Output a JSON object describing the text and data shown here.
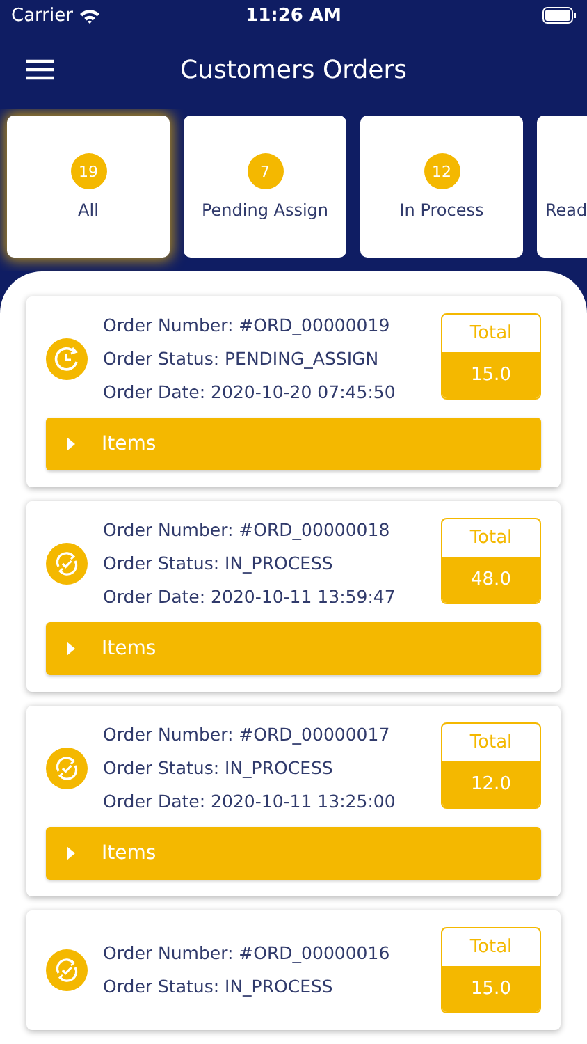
{
  "status_bar": {
    "carrier": "Carrier",
    "time": "11:26 AM"
  },
  "header": {
    "title": "Customers Orders"
  },
  "tabs": [
    {
      "count": "19",
      "label": "All",
      "selected": true
    },
    {
      "count": "7",
      "label": "Pending Assign",
      "selected": false
    },
    {
      "count": "12",
      "label": "In Process",
      "selected": false
    },
    {
      "label": "Read",
      "selected": false
    }
  ],
  "orders": [
    {
      "kind": "pending",
      "number": "Order Number: #ORD_00000019",
      "status": "Order Status: PENDING_ASSIGN",
      "date": "Order Date: 2020-10-20 07:45:50",
      "total_label": "Total",
      "total": "15.0",
      "items_label": "Items",
      "expanded": false
    },
    {
      "kind": "in_process",
      "number": "Order Number: #ORD_00000018",
      "status": "Order Status: IN_PROCESS",
      "date": "Order Date: 2020-10-11 13:59:47",
      "total_label": "Total",
      "total": "48.0",
      "items_label": "Items",
      "expanded": false
    },
    {
      "kind": "in_process",
      "number": "Order Number: #ORD_00000017",
      "status": "Order Status: IN_PROCESS",
      "date": "Order Date: 2020-10-11 13:25:00",
      "total_label": "Total",
      "total": "12.0",
      "items_label": "Items",
      "expanded": false
    },
    {
      "kind": "in_process",
      "number": "Order Number: #ORD_00000016",
      "status": "Order Status: IN_PROCESS",
      "total_label": "Total",
      "total": "15.0"
    }
  ]
}
